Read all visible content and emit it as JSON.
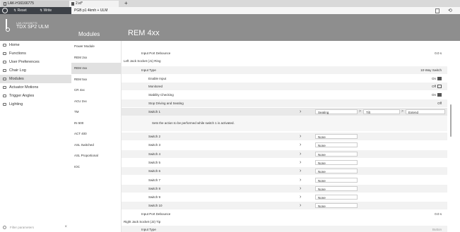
{
  "tabs": [
    {
      "label": "LAK-H16166775"
    },
    {
      "label": "2.id*"
    }
  ],
  "toolbar": {
    "reset_label": "Reset",
    "write_label": "Write",
    "breadcrumb": "PGB p1 4kmh + ULM"
  },
  "device": {
    "id": "LAK-H16166775",
    "name": "TDX SP2 ULM"
  },
  "nav": {
    "items": [
      {
        "label": "Home"
      },
      {
        "label": "Functions"
      },
      {
        "label": "User Preferences"
      },
      {
        "label": "Chair Log"
      },
      {
        "label": "Modules"
      },
      {
        "label": "Actuator Motions"
      },
      {
        "label": "Trigger Angles"
      },
      {
        "label": "Lighting"
      }
    ],
    "search_placeholder": "Filter parameters"
  },
  "modules": {
    "heading": "Modules",
    "items": [
      {
        "label": "Power Module"
      },
      {
        "label": "REM 2xx"
      },
      {
        "label": "REM 4xx"
      },
      {
        "label": "REM 5xx"
      },
      {
        "label": "CR 4xx"
      },
      {
        "label": "ACU 2xx"
      },
      {
        "label": "TM"
      },
      {
        "label": "IN 500"
      },
      {
        "label": "ACT 400"
      },
      {
        "label": "ASL Switched"
      },
      {
        "label": "ASL Proportional"
      },
      {
        "label": "IOC"
      }
    ]
  },
  "content": {
    "title": "REM 4xx",
    "rows": {
      "input_port_debounce_1": {
        "label": "Input Port Debounce",
        "value": "0.0 s"
      },
      "left_jack_heading": "Left Jack Socket (J1) Ring",
      "input_type": {
        "label": "Input Type",
        "value": "10-Way Switch"
      },
      "enable_input": {
        "label": "Enable Input",
        "value": "On"
      },
      "monitored": {
        "label": "Monitored",
        "value": "Off"
      },
      "stability_checking": {
        "label": "Stability Checking",
        "value": "On"
      },
      "stop_driving": {
        "label": "Stop Driving and Seating",
        "value": "Off"
      },
      "switch1": {
        "label": "Switch 1",
        "seating": "Seating",
        "tilt": "Tilt",
        "extend": "Extend"
      },
      "switch1_desc": "Sets the action to be performed while switch 1 is activated.",
      "switches": [
        {
          "label": "Switch 2",
          "value": "None"
        },
        {
          "label": "Switch 3",
          "value": "None"
        },
        {
          "label": "Switch 4",
          "value": "None"
        },
        {
          "label": "Switch 5",
          "value": "None"
        },
        {
          "label": "Switch 6",
          "value": "None"
        },
        {
          "label": "Switch 7",
          "value": "None"
        },
        {
          "label": "Switch 8",
          "value": "None"
        },
        {
          "label": "Switch 9",
          "value": "None"
        },
        {
          "label": "Switch 10",
          "value": "None"
        }
      ],
      "input_port_debounce_2": {
        "label": "Input Port Debounce",
        "value": "0.0 s"
      },
      "right_jack_heading": "Right Jack Socket (J2) Tip",
      "input_type_2": {
        "label": "Input Type",
        "value": "Button"
      }
    }
  },
  "colors": {
    "header_gray": "#8e8e8e",
    "toolbar_dark": "#3d4147",
    "active_bg": "#e1e1e1"
  }
}
